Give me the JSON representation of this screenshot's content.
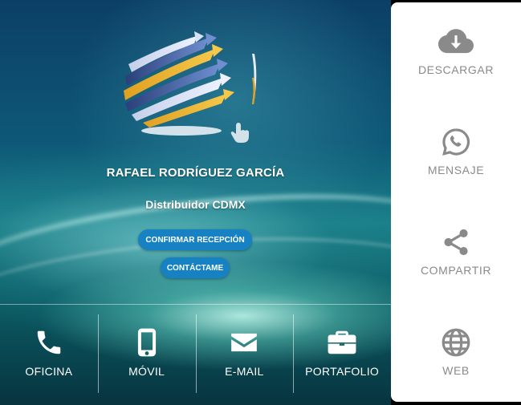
{
  "profile": {
    "name": "RAFAEL RODRÍGUEZ GARCÍA",
    "role": "Distribuidor CDMX"
  },
  "actions": {
    "confirm_label": "CONFIRMAR RECEPCIÓN",
    "contact_label": "CONTÁCTAME"
  },
  "bottom_bar": {
    "items": [
      {
        "label": "OFICINA",
        "icon": "phone-icon"
      },
      {
        "label": "MÓVIL",
        "icon": "mobile-icon"
      },
      {
        "label": "E-MAIL",
        "icon": "envelope-icon"
      },
      {
        "label": "PORTAFOLIO",
        "icon": "briefcase-icon"
      }
    ]
  },
  "side_panel": {
    "items": [
      {
        "label": "DESCARGAR",
        "icon": "cloud-download-icon"
      },
      {
        "label": "MENSAJE",
        "icon": "whatsapp-icon"
      },
      {
        "label": "COMPARTIR",
        "icon": "share-icon"
      },
      {
        "label": "WEB",
        "icon": "globe-icon"
      }
    ]
  },
  "colors": {
    "accent_button": "#1682c4",
    "side_icon": "#8a8a8a",
    "side_background": "#ffffff"
  }
}
